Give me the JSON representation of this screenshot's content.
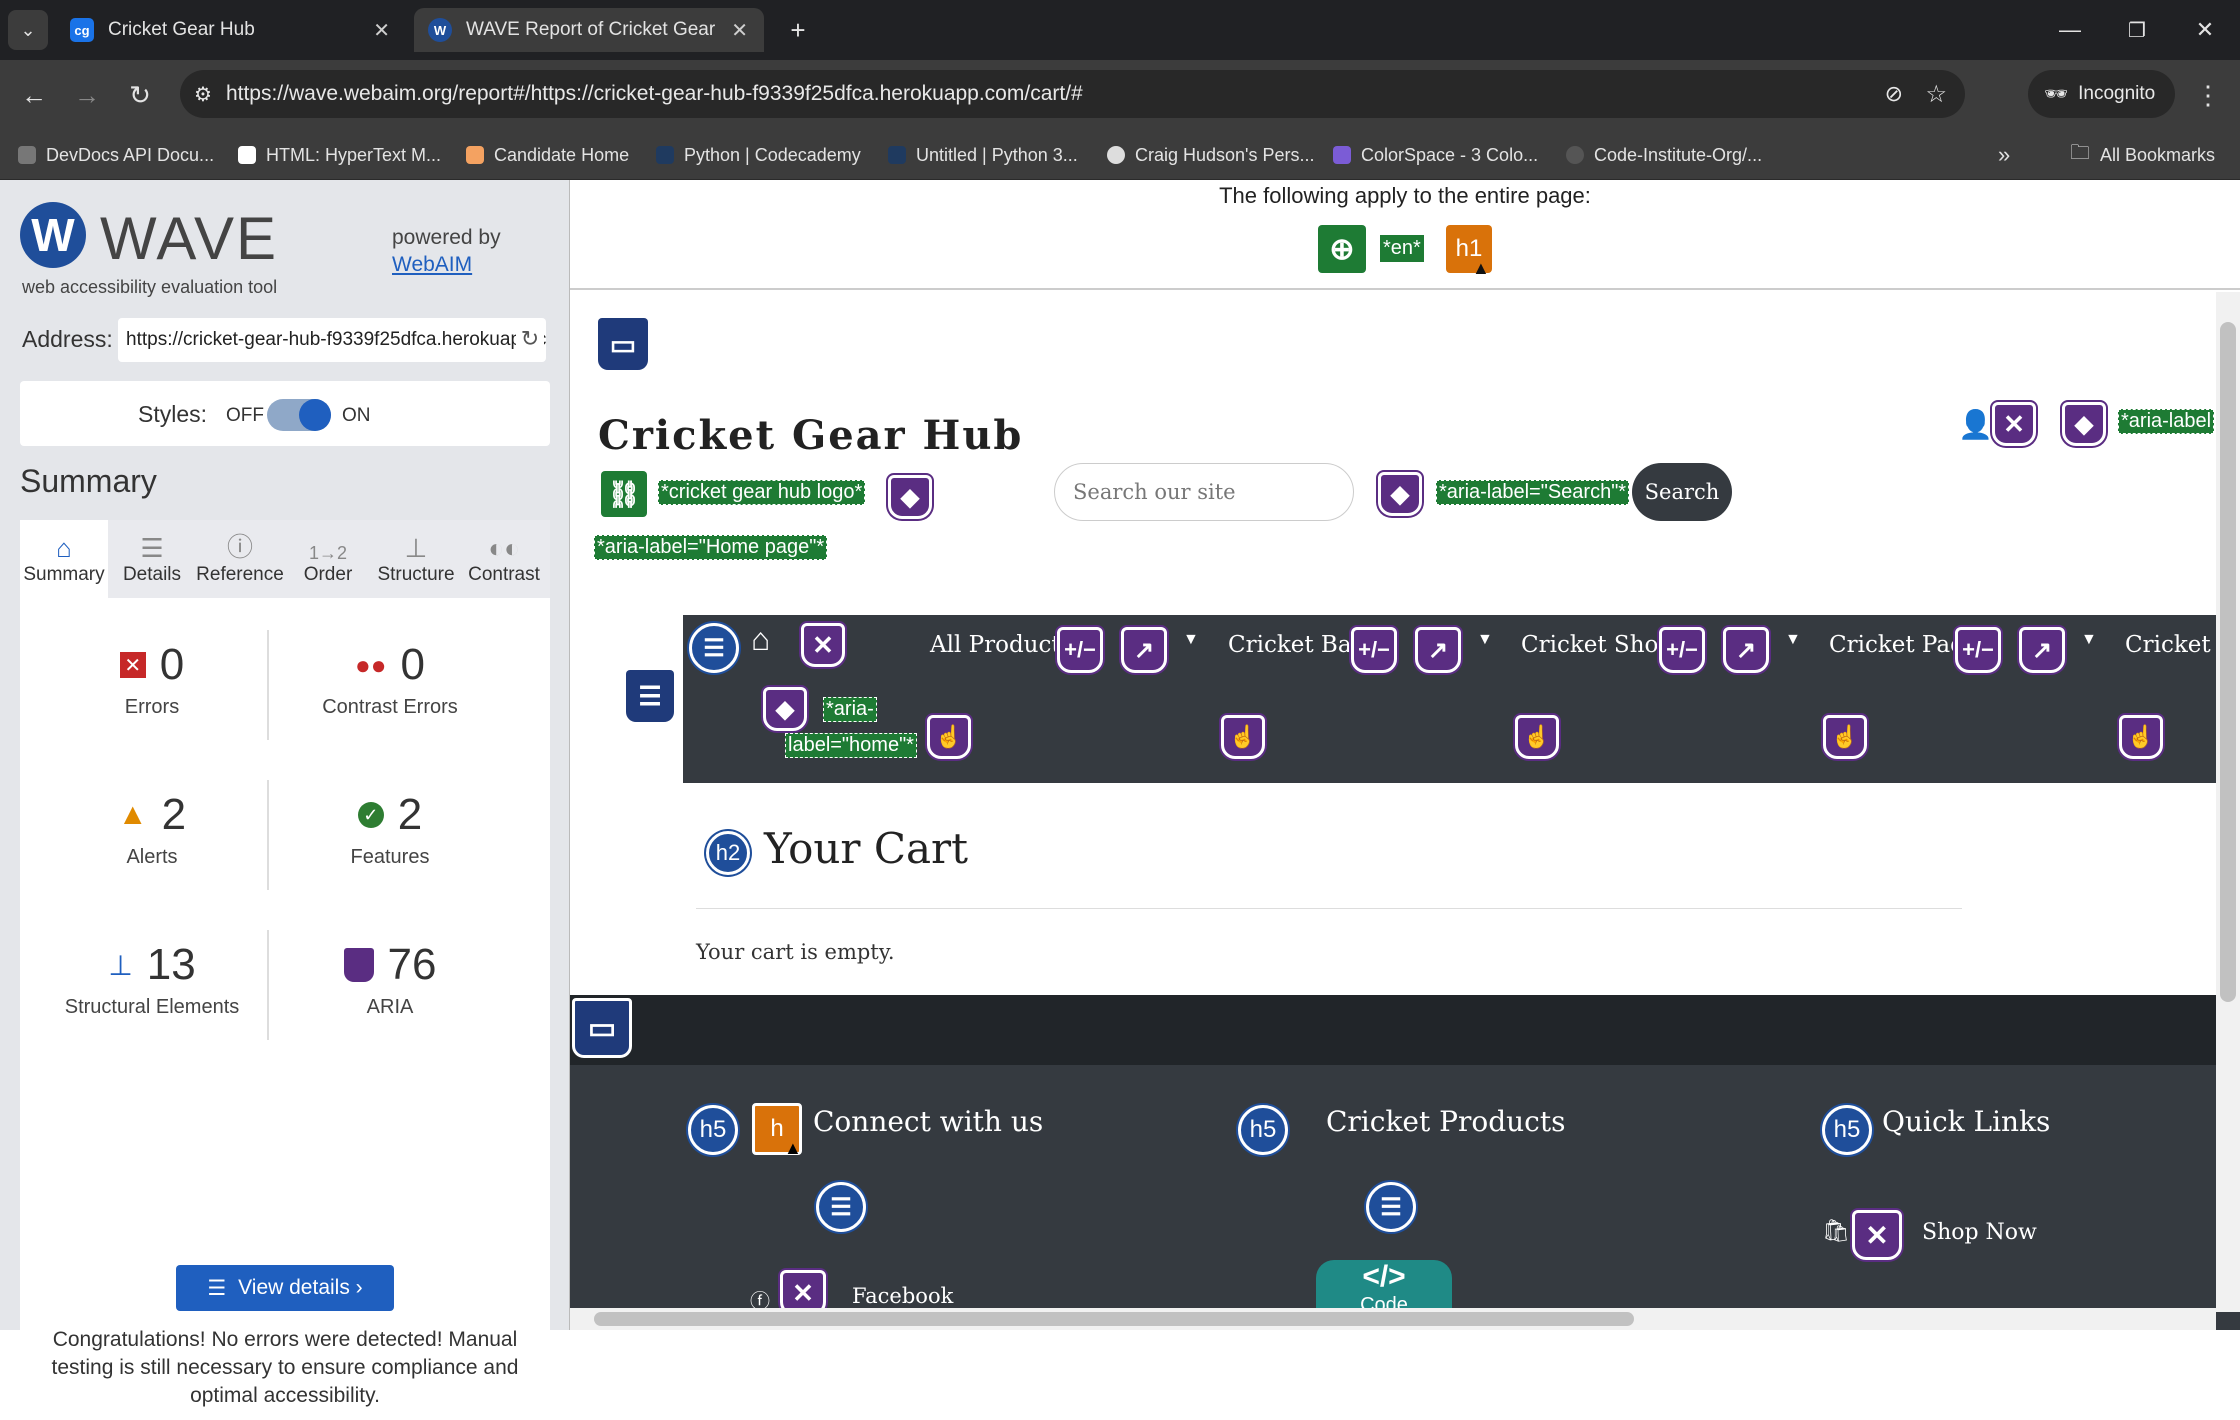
{
  "browser": {
    "tabs": [
      {
        "title": "Cricket Gear Hub",
        "icon": "cricket-gear-hub-favicon"
      },
      {
        "title": "WAVE Report of Cricket Gear Hu",
        "icon": "wave-favicon"
      }
    ],
    "url": "https://wave.webaim.org/report#/https://cricket-gear-hub-f9339f25dfca.herokuapp.com/cart/#",
    "profile_label": "Incognito",
    "bookmarks": [
      "DevDocs API Docu...",
      "HTML: HyperText M...",
      "Candidate Home",
      "Python | Codecademy",
      "Untitled | Python 3...",
      "Craig Hudson's Pers...",
      "ColorSpace - 3 Colo...",
      "Code-Institute-Org/..."
    ],
    "all_bookmarks_label": "All Bookmarks"
  },
  "wave": {
    "logo_text": "WAVE",
    "tagline": "web accessibility evaluation tool",
    "powered_by": "powered by",
    "webaim_link": "WebAIM",
    "address_label": "Address:",
    "address_value": "https://cricket-gear-hub-f9339f25dfca.herokuapp.com/cart/",
    "styles_label": "Styles:",
    "styles_off": "OFF",
    "styles_on": "ON",
    "summary_heading": "Summary",
    "tabs": [
      "Summary",
      "Details",
      "Reference",
      "Order",
      "Structure",
      "Contrast"
    ],
    "stats": {
      "errors": {
        "value": "0",
        "label": "Errors"
      },
      "contrast_errors": {
        "value": "0",
        "label": "Contrast Errors"
      },
      "alerts": {
        "value": "2",
        "label": "Alerts"
      },
      "features": {
        "value": "2",
        "label": "Features"
      },
      "structural": {
        "value": "13",
        "label": "Structural Elements"
      },
      "aria": {
        "value": "76",
        "label": "ARIA"
      }
    },
    "view_details": "View details ›",
    "congrats": "Congratulations! No errors were detected! Manual testing is still necessary to ensure compliance and optimal accessibility."
  },
  "page": {
    "applies_text": "The following apply to the entire page:",
    "lang_tag": "*en*",
    "h1_tag": "h1",
    "site_title": "Cricket Gear Hub",
    "logo_alt": "*cricket gear hub logo*",
    "home_aria": "*aria-label=\"Home page\"*",
    "search_placeholder": "Search our site",
    "search_aria": "*aria-label=\"Search\"*",
    "search_button": "Search",
    "top_right_aria": "*aria-label",
    "nav": {
      "home_aria_1": "*aria-",
      "home_aria_2": "label=\"home\"*",
      "links": [
        "All Products",
        "Cricket Bats",
        "Cricket Shoes",
        "Cricket Pads",
        "Cricket C"
      ]
    },
    "cart": {
      "h2_tag": "h2",
      "heading": "Your Cart",
      "empty": "Your cart is empty."
    },
    "footer": {
      "h5_tag": "h5",
      "h_alert": "h",
      "col1": "Connect with us",
      "col2": "Cricket Products",
      "col3": "Quick Links",
      "facebook": "Facebook",
      "shop_now": "Shop Now",
      "code_label": "Code"
    }
  }
}
